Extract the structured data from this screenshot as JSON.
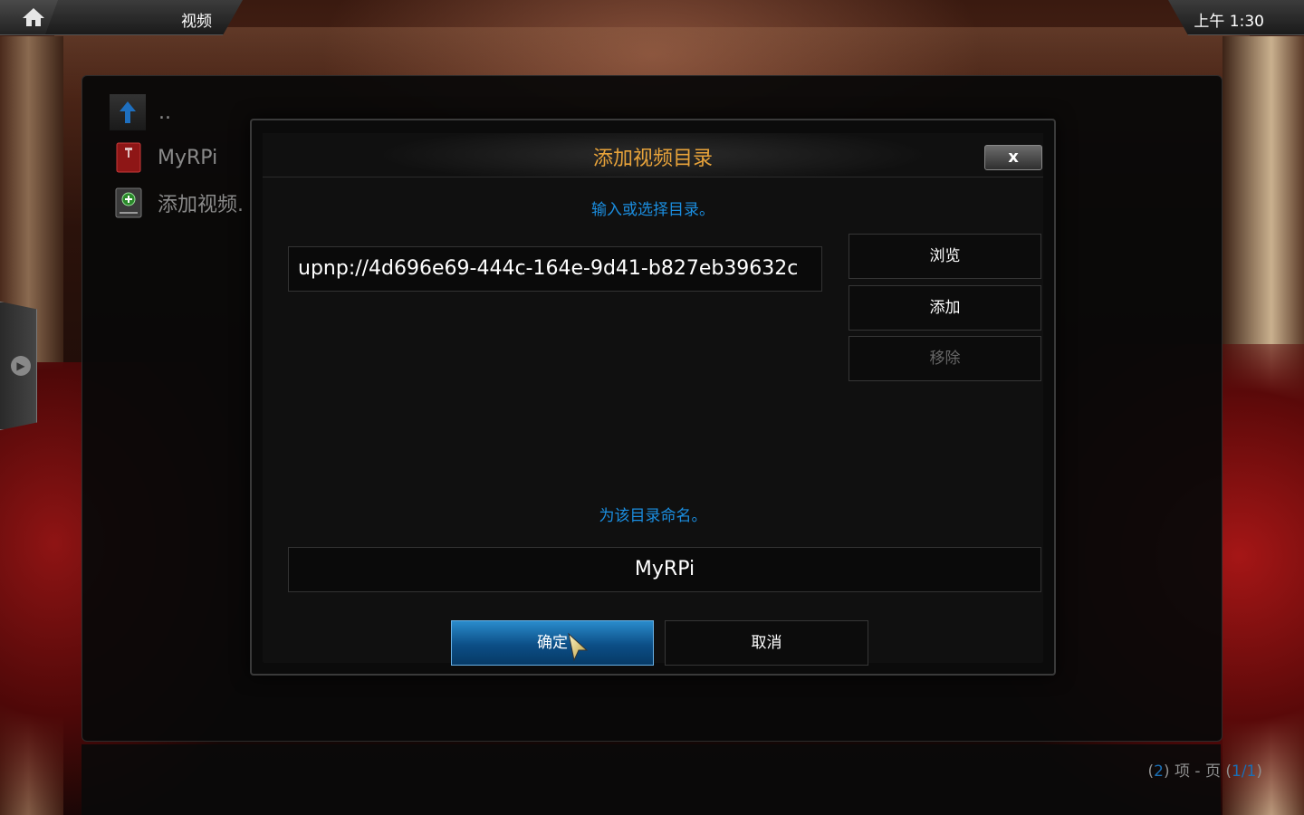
{
  "topbar": {
    "title": "视频",
    "clock": "上午 1:30",
    "home_icon": "home-icon"
  },
  "list": {
    "items": [
      {
        "label": "..",
        "icon": "up-arrow-icon"
      },
      {
        "label": "MyRPi",
        "icon": "folder-icon"
      },
      {
        "label": "添加视频.",
        "icon": "add-source-icon"
      }
    ]
  },
  "footer": {
    "open_paren": "(",
    "count": "2",
    "items_text": ") 项 - 页 (",
    "page": "1/1",
    "close_paren": ")"
  },
  "dialog": {
    "title": "添加视频目录",
    "close_label": "x",
    "path_prompt": "输入或选择目录。",
    "path_value": "upnp://4d696e69-444c-164e-9d41-b827eb39632c",
    "browse_label": "浏览",
    "add_label": "添加",
    "remove_label": "移除",
    "name_prompt": "为该目录命名。",
    "name_value": "MyRPi",
    "ok_label": "确定",
    "cancel_label": "取消"
  },
  "colors": {
    "title_orange": "#e8a33a",
    "prompt_blue": "#1b8ee0",
    "ok_blue": "#0c4e86"
  }
}
